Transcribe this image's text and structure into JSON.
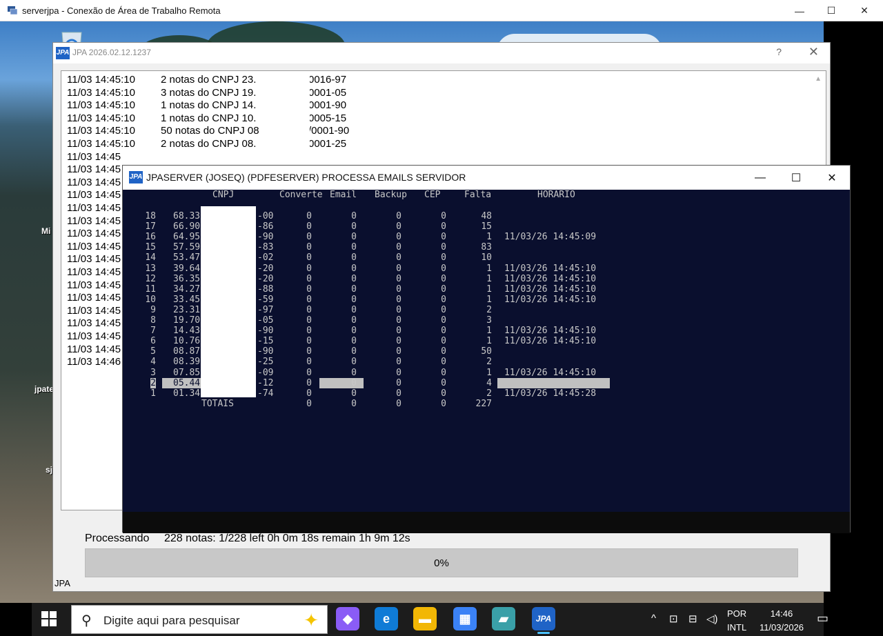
{
  "rdp": {
    "title": "serverjpa - Conexão de Área de Trabalho Remota",
    "minimize": "—",
    "maximize": "☐",
    "close": "✕"
  },
  "desktop": {
    "icons": [
      {
        "label": "Mi"
      },
      {
        "label": "jpate"
      },
      {
        "label": "sj"
      }
    ]
  },
  "jpa_window": {
    "logo": "JPA",
    "title": "JPA 2026.02.12.1237",
    "help": "?",
    "close": "✕",
    "log_lines": [
      {
        "time": "11/03 14:45:10",
        "msg": "2 notas do CNPJ 23.",
        "cnpj_tail": "0016-97"
      },
      {
        "time": "11/03 14:45:10",
        "msg": "3 notas do CNPJ 19.",
        "cnpj_tail": "0001-05"
      },
      {
        "time": "11/03 14:45:10",
        "msg": "1 notas do CNPJ 14.",
        "cnpj_tail": "0001-90"
      },
      {
        "time": "11/03 14:45:10",
        "msg": "1 notas do CNPJ 10.",
        "cnpj_tail": "0005-15"
      },
      {
        "time": "11/03 14:45:10",
        "msg": "50 notas do CNPJ 08",
        "cnpj_tail": "/0001-90"
      },
      {
        "time": "11/03 14:45:10",
        "msg": "2 notas do CNPJ 08.",
        "cnpj_tail": "0001-25"
      },
      {
        "time": "11/03 14:45",
        "msg": "",
        "cnpj_tail": ""
      },
      {
        "time": "11/03 14:45",
        "msg": "",
        "cnpj_tail": ""
      },
      {
        "time": "11/03 14:45",
        "msg": "",
        "cnpj_tail": ""
      },
      {
        "time": "11/03 14:45",
        "msg": "",
        "cnpj_tail": ""
      },
      {
        "time": "11/03 14:45",
        "msg": "",
        "cnpj_tail": ""
      },
      {
        "time": "11/03 14:45",
        "msg": "",
        "cnpj_tail": ""
      },
      {
        "time": "11/03 14:45",
        "msg": "",
        "cnpj_tail": ""
      },
      {
        "time": "11/03 14:45",
        "msg": "",
        "cnpj_tail": ""
      },
      {
        "time": "11/03 14:45",
        "msg": "",
        "cnpj_tail": ""
      },
      {
        "time": "11/03 14:45",
        "msg": "",
        "cnpj_tail": ""
      },
      {
        "time": "11/03 14:45",
        "msg": "",
        "cnpj_tail": ""
      },
      {
        "time": "11/03 14:45",
        "msg": "",
        "cnpj_tail": ""
      },
      {
        "time": "11/03 14:45",
        "msg": "",
        "cnpj_tail": ""
      },
      {
        "time": "11/03 14:45",
        "msg": "",
        "cnpj_tail": ""
      },
      {
        "time": "11/03 14:45",
        "msg": "",
        "cnpj_tail": ""
      },
      {
        "time": "11/03 14:45",
        "msg": "",
        "cnpj_tail": ""
      },
      {
        "time": "11/03 14:46",
        "msg": "",
        "cnpj_tail": ""
      }
    ],
    "status_label": "Processando",
    "status_text": "228 notas: 1/228 left 0h 0m 18s remain 1h 9m 12s",
    "progress_text": "0%",
    "progress_fraction": 0,
    "footer": "JPA"
  },
  "console": {
    "logo": "JPA",
    "title": "JPASERVER (JOSEQ) (PDFESERVER) PROCESSA EMAILS SERVIDOR",
    "minimize": "—",
    "maximize": "☐",
    "close": "✕",
    "headers": {
      "cnpj": "CNPJ",
      "converte": "Converte",
      "email": "Email",
      "backup": "Backup",
      "cep": "CEP",
      "falta": "Falta",
      "horario": "HORARIO"
    },
    "rows": [
      {
        "n": "18",
        "cnpj_head": "68.33",
        "cnpj_tail": "-00",
        "converte": "0",
        "email": "0",
        "backup": "0",
        "cep": "0",
        "falta": "48",
        "horario": ""
      },
      {
        "n": "17",
        "cnpj_head": "66.90",
        "cnpj_tail": "-86",
        "converte": "0",
        "email": "0",
        "backup": "0",
        "cep": "0",
        "falta": "15",
        "horario": ""
      },
      {
        "n": "16",
        "cnpj_head": "64.95",
        "cnpj_tail": "-90",
        "converte": "0",
        "email": "0",
        "backup": "0",
        "cep": "0",
        "falta": "1",
        "horario": "11/03/26 14:45:09"
      },
      {
        "n": "15",
        "cnpj_head": "57.59",
        "cnpj_tail": "-83",
        "converte": "0",
        "email": "0",
        "backup": "0",
        "cep": "0",
        "falta": "83",
        "horario": ""
      },
      {
        "n": "14",
        "cnpj_head": "53.47",
        "cnpj_tail": "-02",
        "converte": "0",
        "email": "0",
        "backup": "0",
        "cep": "0",
        "falta": "10",
        "horario": ""
      },
      {
        "n": "13",
        "cnpj_head": "39.64",
        "cnpj_tail": "-20",
        "converte": "0",
        "email": "0",
        "backup": "0",
        "cep": "0",
        "falta": "1",
        "horario": "11/03/26 14:45:10"
      },
      {
        "n": "12",
        "cnpj_head": "36.35",
        "cnpj_tail": "-20",
        "converte": "0",
        "email": "0",
        "backup": "0",
        "cep": "0",
        "falta": "1",
        "horario": "11/03/26 14:45:10"
      },
      {
        "n": "11",
        "cnpj_head": "34.27",
        "cnpj_tail": "-88",
        "converte": "0",
        "email": "0",
        "backup": "0",
        "cep": "0",
        "falta": "1",
        "horario": "11/03/26 14:45:10"
      },
      {
        "n": "10",
        "cnpj_head": "33.45",
        "cnpj_tail": "-59",
        "converte": "0",
        "email": "0",
        "backup": "0",
        "cep": "0",
        "falta": "1",
        "horario": "11/03/26 14:45:10"
      },
      {
        "n": "9",
        "cnpj_head": "23.31",
        "cnpj_tail": "-97",
        "converte": "0",
        "email": "0",
        "backup": "0",
        "cep": "0",
        "falta": "2",
        "horario": ""
      },
      {
        "n": "8",
        "cnpj_head": "19.70",
        "cnpj_tail": "-05",
        "converte": "0",
        "email": "0",
        "backup": "0",
        "cep": "0",
        "falta": "3",
        "horario": ""
      },
      {
        "n": "7",
        "cnpj_head": "14.43",
        "cnpj_tail": "-90",
        "converte": "0",
        "email": "0",
        "backup": "0",
        "cep": "0",
        "falta": "1",
        "horario": "11/03/26 14:45:10"
      },
      {
        "n": "6",
        "cnpj_head": "10.76",
        "cnpj_tail": "-15",
        "converte": "0",
        "email": "0",
        "backup": "0",
        "cep": "0",
        "falta": "1",
        "horario": "11/03/26 14:45:10"
      },
      {
        "n": "5",
        "cnpj_head": "08.87",
        "cnpj_tail": "-90",
        "converte": "0",
        "email": "0",
        "backup": "0",
        "cep": "0",
        "falta": "50",
        "horario": ""
      },
      {
        "n": "4",
        "cnpj_head": "08.39",
        "cnpj_tail": "-25",
        "converte": "0",
        "email": "0",
        "backup": "0",
        "cep": "0",
        "falta": "2",
        "horario": ""
      },
      {
        "n": "3",
        "cnpj_head": "07.85",
        "cnpj_tail": "-09",
        "converte": "0",
        "email": "0",
        "backup": "0",
        "cep": "0",
        "falta": "1",
        "horario": "11/03/26 14:45:10"
      },
      {
        "n": "2",
        "cnpj_head": "05.44",
        "cnpj_tail": "-12",
        "converte": "0",
        "email": "0",
        "backup": "0",
        "cep": "0",
        "falta": "4",
        "horario": ""
      },
      {
        "n": "1",
        "cnpj_head": "01.34",
        "cnpj_tail": "-74",
        "converte": "0",
        "email": "0",
        "backup": "0",
        "cep": "0",
        "falta": "2",
        "horario": "11/03/26 14:45:28"
      }
    ],
    "totals": {
      "label": "TOTAIS",
      "converte": "0",
      "email": "0",
      "backup": "0",
      "cep": "0",
      "falta": "227"
    }
  },
  "taskbar": {
    "search_placeholder": "Digite aqui para pesquisar",
    "apps": [
      {
        "name": "copilot",
        "glyph": "◆",
        "color": "#8a5cf6"
      },
      {
        "name": "edge",
        "glyph": "e",
        "color": "#0f7bd6"
      },
      {
        "name": "file-explorer",
        "glyph": "▬",
        "color": "#f2b705"
      },
      {
        "name": "store",
        "glyph": "▦",
        "color": "#3b82f6"
      },
      {
        "name": "app",
        "glyph": "▰",
        "color": "#3aa0a8"
      },
      {
        "name": "jpa",
        "glyph": "JPA",
        "color": "#1f63c6"
      }
    ],
    "tray": {
      "up": "^",
      "meet": "⊡",
      "network": "⊟",
      "volume": "◁)"
    },
    "lang_1": "POR",
    "lang_2": "INTL",
    "time": "14:46",
    "date": "11/03/2026",
    "notif": "▭"
  }
}
